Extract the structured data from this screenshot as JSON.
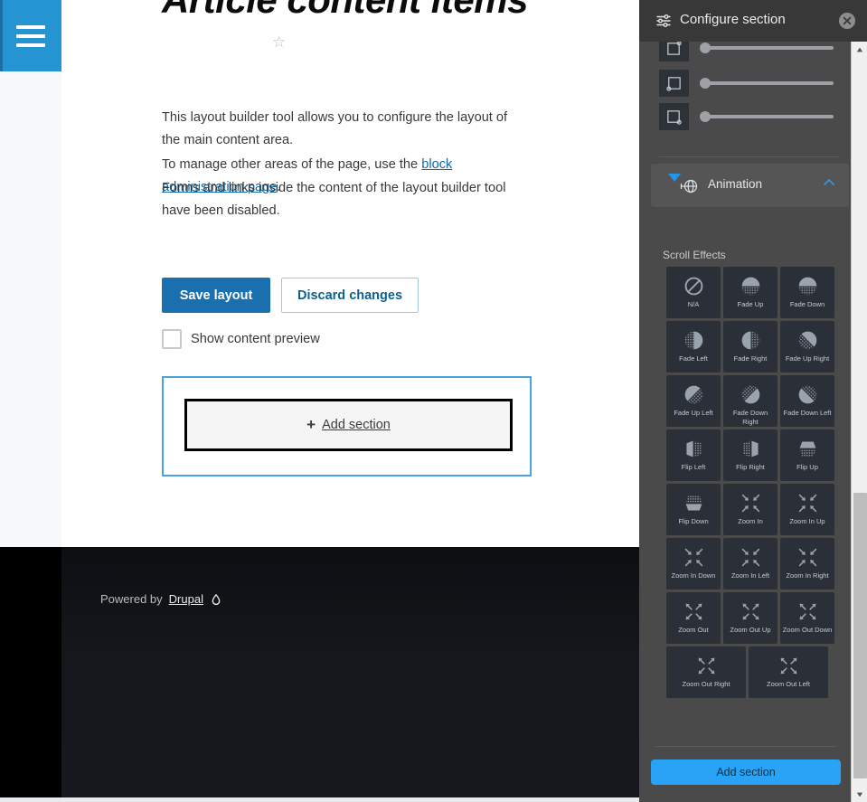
{
  "left_rail": {
    "menu_icon": "hamburger-menu-icon"
  },
  "main": {
    "title": "Article content items",
    "favorite_icon": "star-outline-icon",
    "paragraphs": {
      "p1": "This layout builder tool allows you to configure the layout of the main content area.",
      "p2_before": "To manage other areas of the page, use the ",
      "p2_link": "block administration page",
      "p2_after": ".",
      "p3": "Forms and links inside the content of the layout builder tool have been disabled."
    },
    "save_label": "Save layout",
    "discard_label": "Discard changes",
    "checkbox_label": "Show content preview",
    "checkbox_checked": "false",
    "add_section_label": "Add section",
    "add_section_plus": "+"
  },
  "footer": {
    "powered_by": "Powered by",
    "drupal_link": "Drupal",
    "drupal_icon": "drupal-drop-icon"
  },
  "panel": {
    "header_icon": "sliders-settings-icon",
    "title": "Configure section",
    "close_icon": "close-circle-icon",
    "sliders": [
      {
        "name": "border-radius-top-right",
        "icon": "square-corner-top-right-icon",
        "value": 0
      },
      {
        "name": "border-radius-bottom-left",
        "icon": "square-corner-bottom-left-icon",
        "value": 0
      },
      {
        "name": "border-radius-bottom-right",
        "icon": "square-corner-bottom-right-icon",
        "value": 0
      }
    ],
    "animation": {
      "caret_icon": "caret-down-icon",
      "icon": "animation-cube-icon",
      "label": "Animation",
      "collapse_icon": "chevron-up-icon"
    },
    "scroll_effects_label": "Scroll Effects",
    "scroll_effects": [
      {
        "label": "N/A",
        "icon": "no-entry-icon"
      },
      {
        "label": "Fade Up",
        "icon": "fade-up-icon"
      },
      {
        "label": "Fade Down",
        "icon": "fade-down-icon"
      },
      {
        "label": "Fade Left",
        "icon": "fade-left-icon"
      },
      {
        "label": "Fade Right",
        "icon": "fade-right-icon"
      },
      {
        "label": "Fade Up Right",
        "icon": "fade-up-right-icon"
      },
      {
        "label": "Fade Up Left",
        "icon": "fade-up-left-icon"
      },
      {
        "label": "Fade Down Right",
        "icon": "fade-down-right-icon"
      },
      {
        "label": "Fade Down Left",
        "icon": "fade-down-left-icon"
      },
      {
        "label": "Flip Left",
        "icon": "flip-left-icon"
      },
      {
        "label": "Flip Right",
        "icon": "flip-right-icon"
      },
      {
        "label": "Flip Up",
        "icon": "flip-up-icon"
      },
      {
        "label": "Flip Down",
        "icon": "flip-down-icon"
      },
      {
        "label": "Zoom In",
        "icon": "zoom-in-icon"
      },
      {
        "label": "Zoom In Up",
        "icon": "zoom-in-up-icon"
      },
      {
        "label": "Zoom In Down",
        "icon": "zoom-in-down-icon"
      },
      {
        "label": "Zoom In Left",
        "icon": "zoom-in-left-icon"
      },
      {
        "label": "Zoom In Right",
        "icon": "zoom-in-right-icon"
      },
      {
        "label": "Zoom Out",
        "icon": "zoom-out-icon"
      },
      {
        "label": "Zoom Out Up",
        "icon": "zoom-out-up-icon"
      },
      {
        "label": "Zoom Out Down",
        "icon": "zoom-out-down-icon"
      },
      {
        "label": "Zoom Out Right",
        "icon": "zoom-out-right-icon"
      },
      {
        "label": "Zoom Out Left",
        "icon": "zoom-out-left-icon"
      }
    ],
    "add_section_label": "Add section"
  },
  "colors": {
    "accent_blue": "#2494d2",
    "primary_button": "#1a6fae",
    "panel_bg": "#4a4a4a",
    "panel_header": "#383838",
    "tile_bg": "#2b3038",
    "panel_button": "#29a3f5",
    "section_outline": "#4aa3dd"
  }
}
